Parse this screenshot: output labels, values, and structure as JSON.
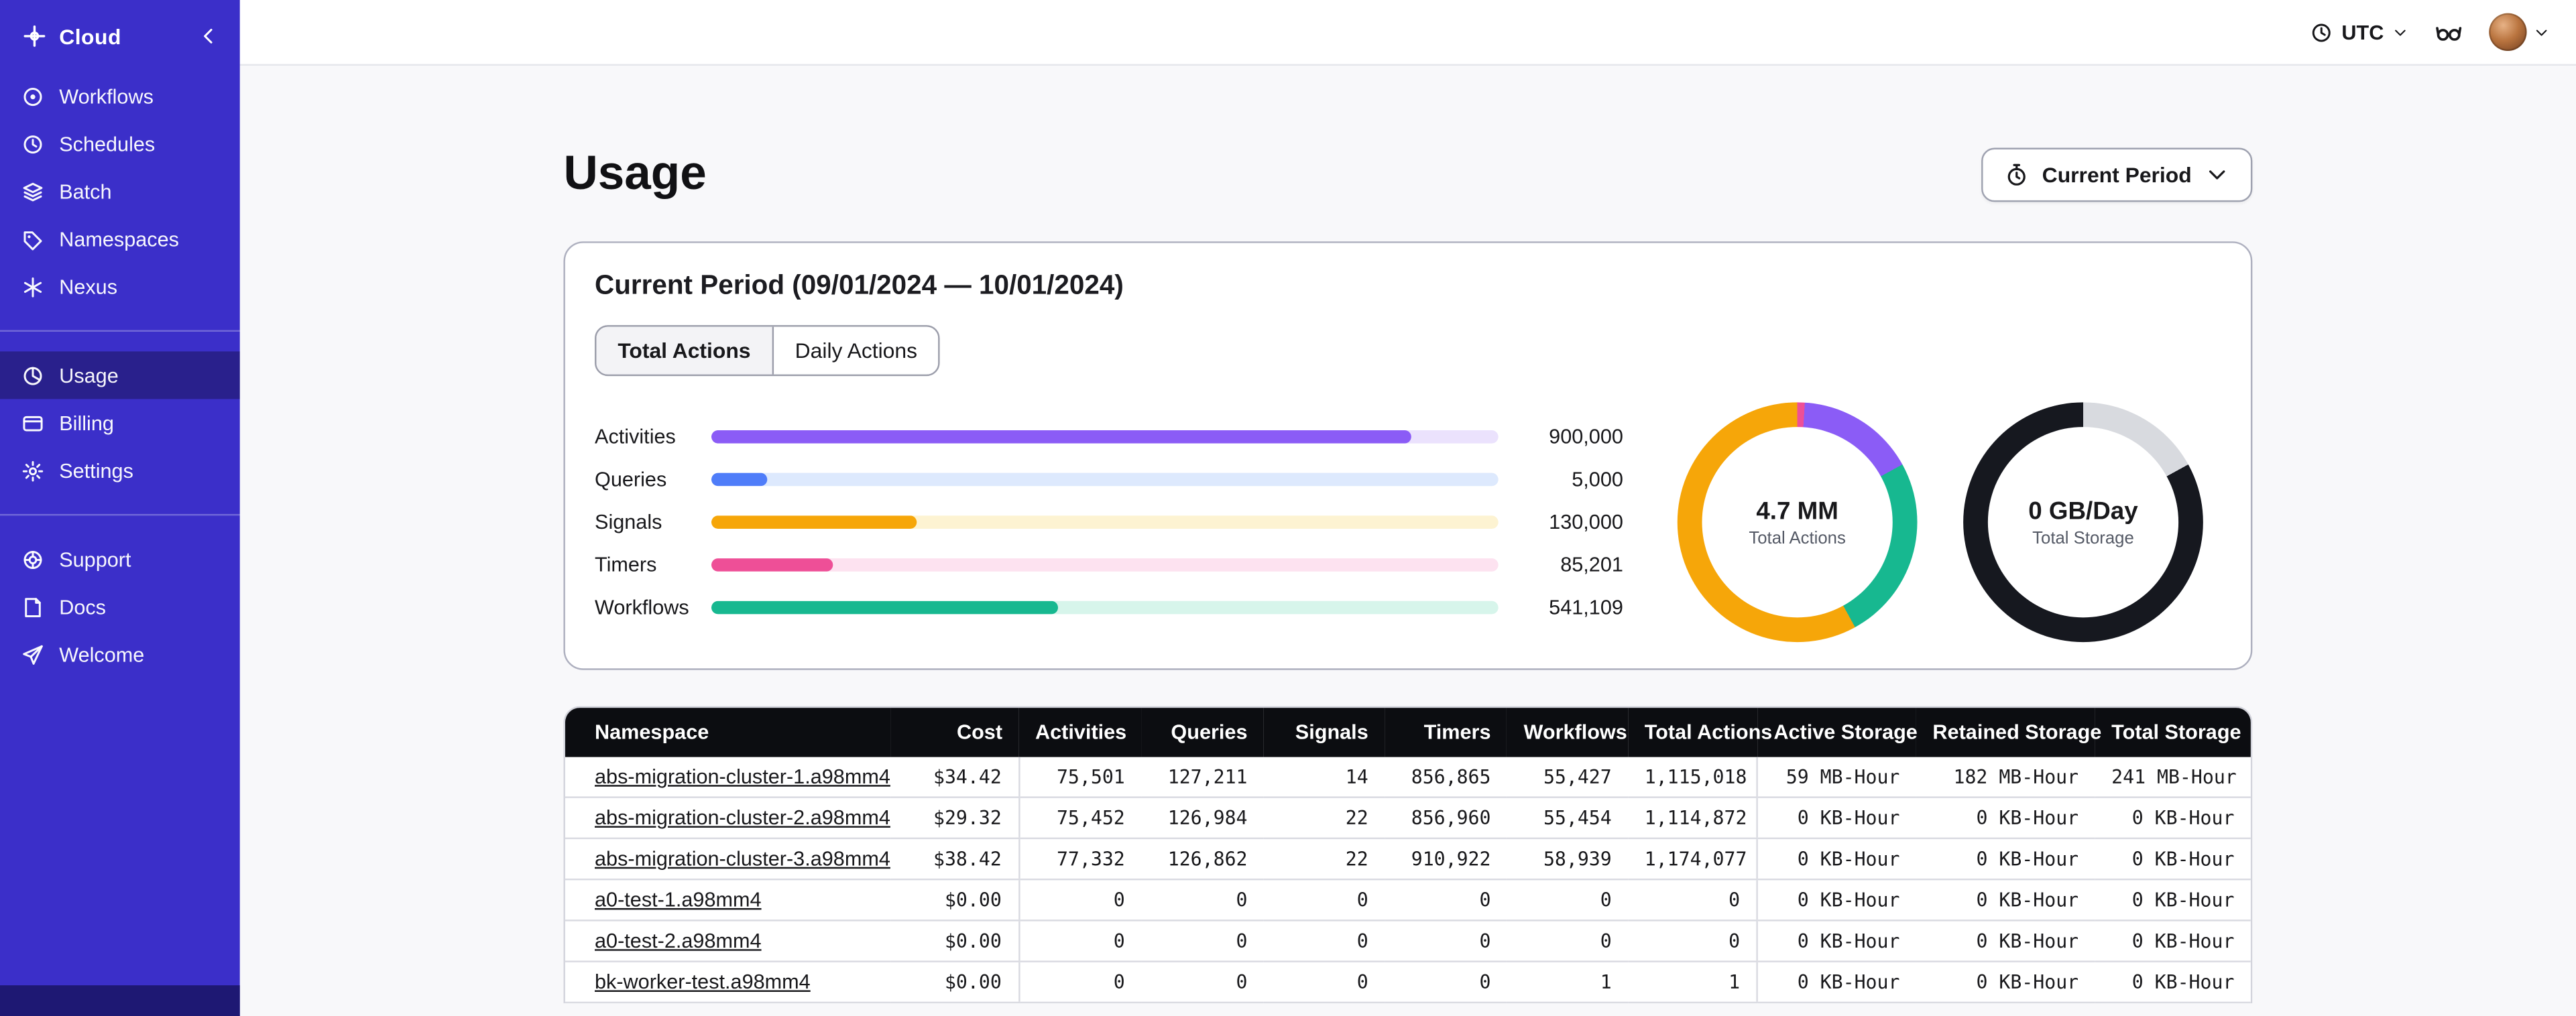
{
  "colors": {
    "sidebar_bg": "#3b2fc9",
    "sidebar_footer_bg": "#1e1873",
    "content_bg": "#f8f8fa",
    "table_header_bg": "#0c0d11",
    "activities_purple": "#8b5cf6",
    "queries_blue": "#4f7df9",
    "signals_orange": "#f6a609",
    "timers_pink": "#ee4f97",
    "workflows_green": "#17b890"
  },
  "sidebar": {
    "brand": "Cloud",
    "groups": [
      {
        "items": [
          {
            "label": "Workflows",
            "icon": "workflows-icon",
            "active": false
          },
          {
            "label": "Schedules",
            "icon": "schedules-icon",
            "active": false
          },
          {
            "label": "Batch",
            "icon": "batch-icon",
            "active": false
          },
          {
            "label": "Namespaces",
            "icon": "namespaces-icon",
            "active": false
          },
          {
            "label": "Nexus",
            "icon": "nexus-icon",
            "active": false
          }
        ]
      },
      {
        "items": [
          {
            "label": "Usage",
            "icon": "usage-icon",
            "active": true
          },
          {
            "label": "Billing",
            "icon": "billing-icon",
            "active": false
          },
          {
            "label": "Settings",
            "icon": "settings-icon",
            "active": false
          }
        ]
      },
      {
        "items": [
          {
            "label": "Support",
            "icon": "support-icon",
            "active": false
          },
          {
            "label": "Docs",
            "icon": "docs-icon",
            "active": false
          },
          {
            "label": "Welcome",
            "icon": "paper-plane-icon",
            "active": false
          }
        ]
      }
    ]
  },
  "topbar": {
    "timezone": "UTC"
  },
  "page": {
    "title": "Usage",
    "period_selector": "Current Period"
  },
  "usage_card": {
    "title": "Current Period (09/01/2024 — 10/01/2024)",
    "tabs": [
      {
        "label": "Total Actions",
        "active": true
      },
      {
        "label": "Daily Actions",
        "active": false
      }
    ]
  },
  "chart_data": [
    {
      "type": "bar",
      "orientation": "horizontal",
      "categories": [
        "Activities",
        "Queries",
        "Signals",
        "Timers",
        "Workflows"
      ],
      "values": [
        900000,
        5000,
        130000,
        85201,
        541109
      ],
      "value_labels": [
        "900,000",
        "5,000",
        "130,000",
        "85,201",
        "541,109"
      ],
      "bar_fractions": [
        0.89,
        0.07,
        0.26,
        0.155,
        0.44
      ],
      "colors": [
        "#8b5cf6",
        "#4f7df9",
        "#f6a609",
        "#ee4f97",
        "#17b890"
      ],
      "track_colors": [
        "#ebe2fd",
        "#dde9fd",
        "#fdf3d2",
        "#fde2f0",
        "#d7f5eb"
      ],
      "title": "",
      "xlabel": "",
      "ylabel": ""
    },
    {
      "type": "pie",
      "subtype": "donut",
      "center_label": "4.7 MM",
      "center_sublabel": "Total Actions",
      "segments": [
        {
          "name": "timers",
          "color": "#ee4f97",
          "pct": 1
        },
        {
          "name": "activities",
          "color": "#8b5cf6",
          "pct": 16
        },
        {
          "name": "workflows",
          "color": "#17b890",
          "pct": 25
        },
        {
          "name": "signals",
          "color": "#f6a609",
          "pct": 58
        }
      ]
    },
    {
      "type": "pie",
      "subtype": "donut",
      "center_label": "0 GB/Day",
      "center_sublabel": "Total Storage",
      "segments": [
        {
          "name": "retained",
          "color": "#d8dadf",
          "pct": 17
        },
        {
          "name": "active",
          "color": "#16181f",
          "pct": 83
        }
      ]
    }
  ],
  "table": {
    "columns": [
      "Namespace",
      "Cost",
      "Activities",
      "Queries",
      "Signals",
      "Timers",
      "Workflows",
      "Total Actions",
      "Active Storage",
      "Retained Storage",
      "Total Storage"
    ],
    "rows": [
      [
        "abs-migration-cluster-1.a98mm4",
        "$34.42",
        "75,501",
        "127,211",
        "14",
        "856,865",
        "55,427",
        "1,115,018",
        "59 MB-Hour",
        "182 MB-Hour",
        "241 MB-Hour"
      ],
      [
        "abs-migration-cluster-2.a98mm4",
        "$29.32",
        "75,452",
        "126,984",
        "22",
        "856,960",
        "55,454",
        "1,114,872",
        "0 KB-Hour",
        "0 KB-Hour",
        "0 KB-Hour"
      ],
      [
        "abs-migration-cluster-3.a98mm4",
        "$38.42",
        "77,332",
        "126,862",
        "22",
        "910,922",
        "58,939",
        "1,174,077",
        "0 KB-Hour",
        "0 KB-Hour",
        "0 KB-Hour"
      ],
      [
        "a0-test-1.a98mm4",
        "$0.00",
        "0",
        "0",
        "0",
        "0",
        "0",
        "0",
        "0 KB-Hour",
        "0 KB-Hour",
        "0 KB-Hour"
      ],
      [
        "a0-test-2.a98mm4",
        "$0.00",
        "0",
        "0",
        "0",
        "0",
        "0",
        "0",
        "0 KB-Hour",
        "0 KB-Hour",
        "0 KB-Hour"
      ],
      [
        "bk-worker-test.a98mm4",
        "$0.00",
        "0",
        "0",
        "0",
        "0",
        "1",
        "1",
        "0 KB-Hour",
        "0 KB-Hour",
        "0 KB-Hour"
      ]
    ]
  }
}
